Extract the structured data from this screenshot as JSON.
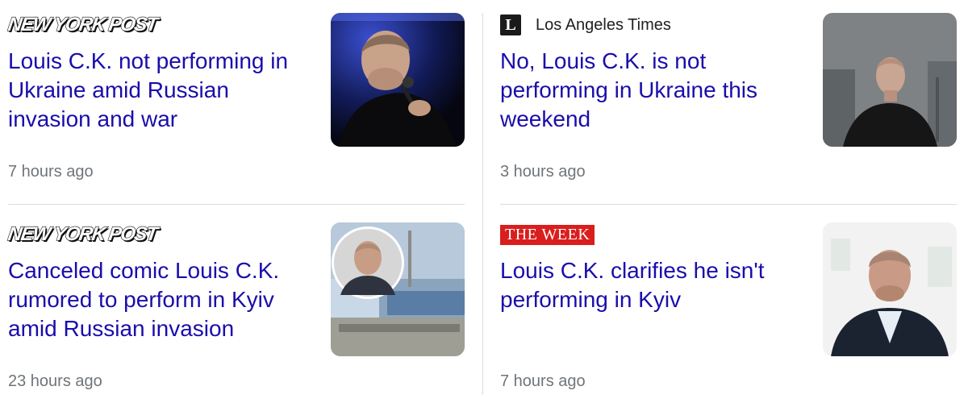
{
  "articles": [
    {
      "source": "NEW YORK POST",
      "headline": "Louis C.K. not performing in Ukraine amid Russian invasion and war",
      "time": "7 hours ago",
      "image": "comedian-with-microphone-photo"
    },
    {
      "source": "Los Angeles Times",
      "source_icon": "L",
      "headline": "No, Louis C.K. is not performing in Ukraine this weekend",
      "time": "3 hours ago",
      "image": "man-in-black-sweater-photo"
    },
    {
      "source": "NEW YORK POST",
      "headline": "Canceled comic Louis C.K. rumored to perform in Kyiv amid Russian invasion",
      "time": "23 hours ago",
      "image": "portrait-inset-and-arena-photo"
    },
    {
      "source": "THE WEEK",
      "headline": "Louis C.K. clarifies he isn't performing in Kyiv",
      "time": "7 hours ago",
      "image": "man-in-suit-photo"
    }
  ],
  "colors": {
    "link": "#1a0dab",
    "meta": "#70757a",
    "divider": "#dadce0",
    "week_red": "#d91e1e"
  }
}
